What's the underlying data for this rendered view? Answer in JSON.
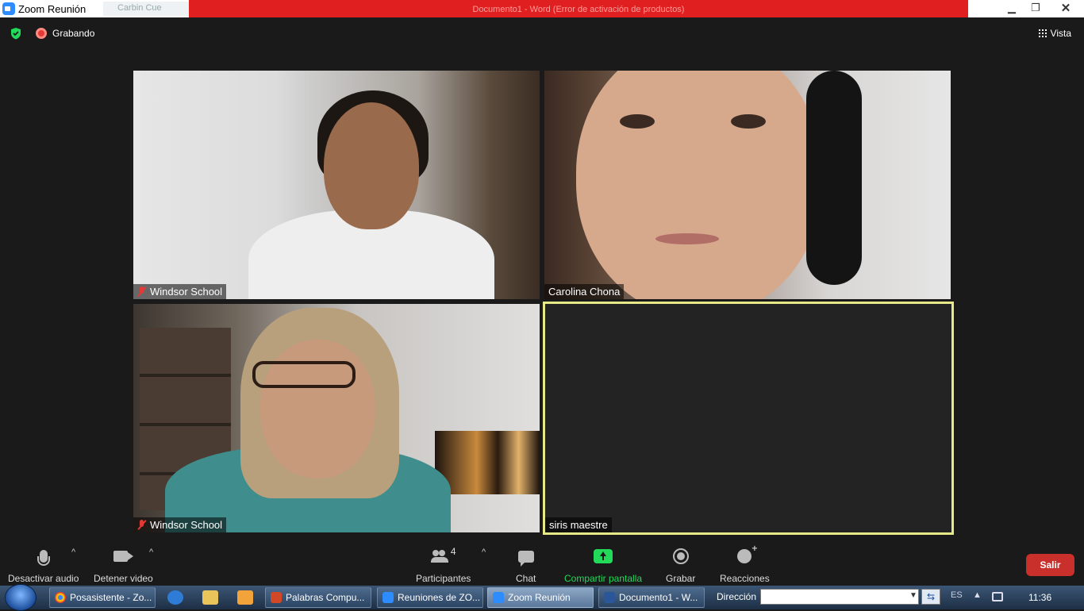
{
  "window": {
    "title": "Zoom Reunión",
    "ghost_tab": "Carbin Cue",
    "ghost_banner": "Documento1 - Word (Error de activación de productos)",
    "minimize": "▁",
    "restore": "❐",
    "close": "✕"
  },
  "topbar": {
    "recording_label": "Grabando",
    "view_label": "Vista"
  },
  "participants": [
    {
      "name": "Windsor School",
      "muted": true
    },
    {
      "name": "Carolina Chona",
      "muted": false
    },
    {
      "name": "Windsor School",
      "muted": true
    },
    {
      "name": "siris maestre",
      "muted": false,
      "active_speaker": true
    }
  ],
  "toolbar": {
    "mute_label": "Desactivar audio",
    "video_label": "Detener video",
    "participants_label": "Participantes",
    "participants_count": "4",
    "chat_label": "Chat",
    "share_label": "Compartir pantalla",
    "record_label": "Grabar",
    "reactions_label": "Reacciones",
    "leave_label": "Salir",
    "caret": "^"
  },
  "taskbar": {
    "items": [
      {
        "label": "Posasistente - Zo...",
        "icon": "chrome-icon"
      },
      {
        "label": "Palabras Compu...",
        "icon": "powerpoint-icon"
      },
      {
        "label": "Reuniones de ZO...",
        "icon": "zoom-icon"
      },
      {
        "label": "Zoom Reunión",
        "icon": "zoom-icon",
        "active": true
      },
      {
        "label": "Documento1 - W...",
        "icon": "word-icon"
      }
    ],
    "address_label": "Dirección",
    "address_value": "",
    "lang": "ES",
    "tray_arrow": "▲",
    "clock": "11:36"
  },
  "colors": {
    "accent_share": "#23d959",
    "leave_button": "#c9302c",
    "active_speaker_border": "#e7e887",
    "recording": "#e53935"
  }
}
